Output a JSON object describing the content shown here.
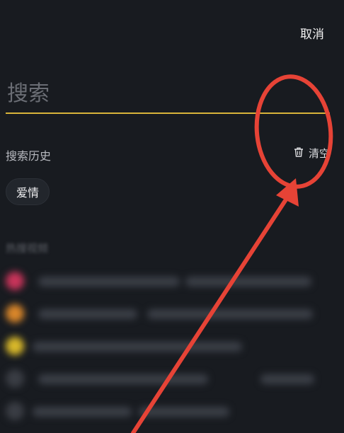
{
  "header": {
    "cancel_label": "取消"
  },
  "search": {
    "placeholder": "搜索"
  },
  "history": {
    "title": "搜索历史",
    "clear_label": "清空",
    "items": [
      "爱情"
    ]
  },
  "hot": {
    "title": "热搜视频",
    "rank_colors": [
      "#c8345a",
      "#d9862a",
      "#d8b82a",
      "#3a3d44",
      "#3a3d44"
    ]
  },
  "annotation": {
    "color": "#e64336"
  }
}
